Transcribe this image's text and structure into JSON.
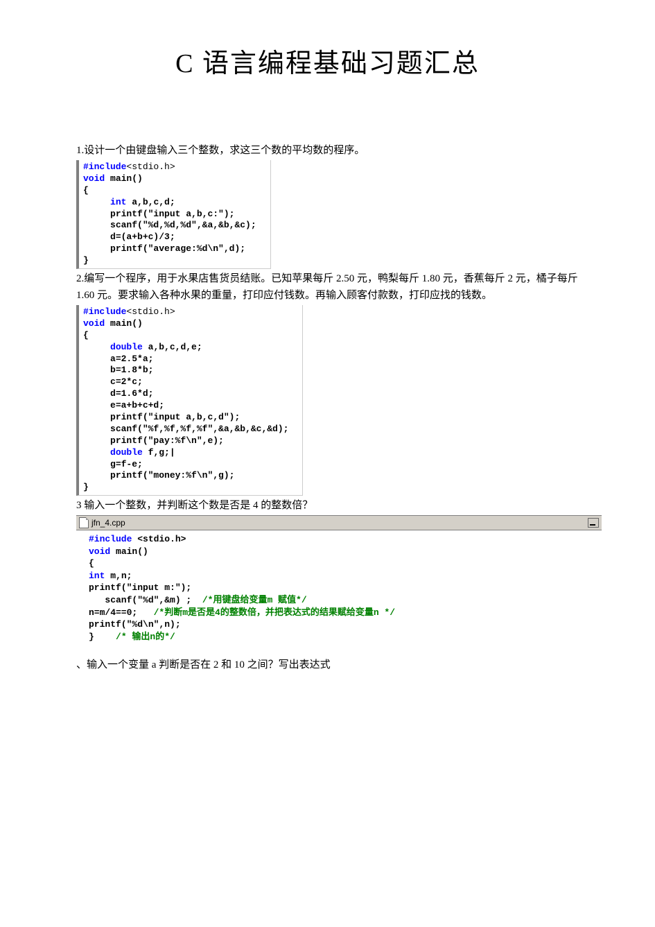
{
  "title": "C 语言编程基础习题汇总",
  "p1": {
    "text": "1.设计一个由键盘输入三个整数，求这三个数的平均数的程序。",
    "code": "#include<stdio.h>\nvoid main()\n{\n     int a,b,c,d;\n     printf(\"input a,b,c:\");\n     scanf(\"%d,%d,%d\",&a,&b,&c);\n     d=(a+b+c)/3;\n     printf(\"average:%d\\n\",d);\n}"
  },
  "p2": {
    "text": "2.编写一个程序，用于水果店售货员结账。已知苹果每斤 2.50 元，鸭梨每斤 1.80 元，香蕉每斤 2 元，橘子每斤 1.60 元。要求输入各种水果的重量，打印应付钱数。再输入顾客付款数，打印应找的钱数。",
    "code": "#include<stdio.h>\nvoid main()\n{\n     double a,b,c,d,e;\n     a=2.5*a;\n     b=1.8*b;\n     c=2*c;\n     d=1.6*d;\n     e=a+b+c+d;\n     printf(\"input a,b,c,d\");\n     scanf(\"%f,%f,%f,%f\",&a,&b,&c,&d);\n     printf(\"pay:%f\\n\",e);\n     double f,g;|\n     g=f-e;\n     printf(\"money:%f\\n\",g);\n}"
  },
  "p3": {
    "text": "3 输入一个整数，并判断这个数是否是 4 的整数倍？",
    "tab": "jfn_4.cpp",
    "line1": "#include <stdio.h>",
    "line2": "void main()",
    "line3": "{",
    "line4": "int m,n;",
    "line5": "printf(\"input m:\");",
    "line6a": "   scanf(\"%d\",&m) ;",
    "line6b": "  /*用键盘给变量m 赋值*/",
    "line7a": "n=m/4==0;",
    "line7b": "   /*判断m是否是4的整数倍，并把表达式的结果赋给变量n */",
    "line8": "printf(\"%d\\n\",n);",
    "line9a": "}",
    "line9b": "    /* 输出n的*/"
  },
  "p4": {
    "text": "、输入一个变量 a 判断是否在 2 和 10 之间？写出表达式"
  }
}
